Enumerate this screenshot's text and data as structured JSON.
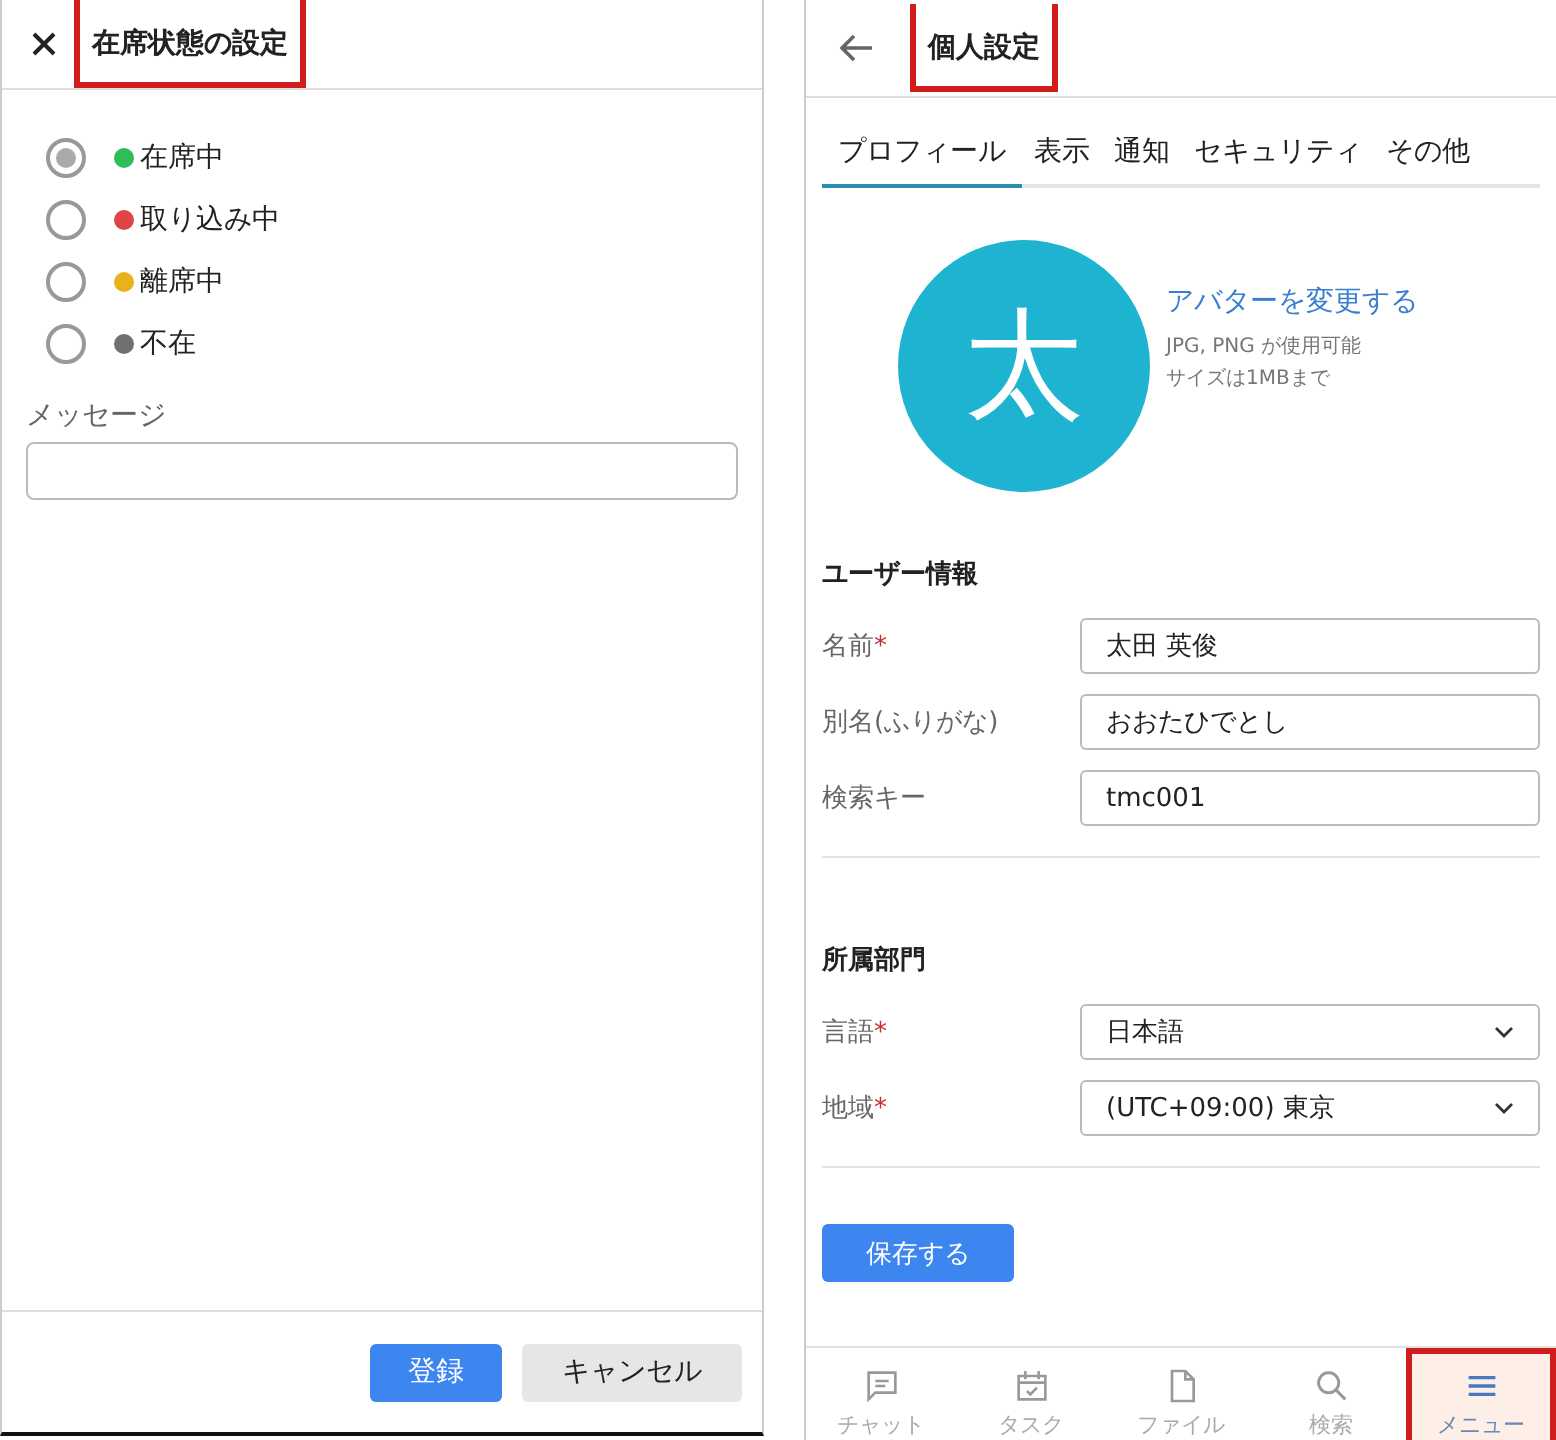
{
  "status_dialog": {
    "title": "在席状態の設定",
    "highlighted": true,
    "statuses": [
      {
        "label": "在席中",
        "color": "#2ebd59",
        "selected": true
      },
      {
        "label": "取り込み中",
        "color": "#e04545",
        "selected": false
      },
      {
        "label": "離席中",
        "color": "#e8b21a",
        "selected": false
      },
      {
        "label": "不在",
        "color": "#707070",
        "selected": false
      }
    ],
    "message": {
      "label": "メッセージ"
    },
    "buttons": [
      {
        "label": "登録",
        "kind": "primary"
      },
      {
        "label": "キャンセル",
        "kind": "secondary"
      }
    ]
  },
  "personal_settings": {
    "title": "個人設定",
    "highlighted": true,
    "tabs": [
      {
        "label": "プロフィール",
        "selected": true
      },
      {
        "label": "表示",
        "selected": false
      },
      {
        "label": "通知",
        "selected": false
      },
      {
        "label": "セキュリティ",
        "selected": false
      },
      {
        "label": "その他",
        "selected": false
      }
    ],
    "avatar": {
      "initial": "太",
      "link": "アバターを変更する",
      "notes": [
        "JPG, PNG が使用可能",
        "サイズは1MBまで"
      ]
    },
    "sections": [
      {
        "heading": "ユーザー情報",
        "fields": [
          {
            "label": "名前",
            "required_mark": "*",
            "kind": "text",
            "value": "太田 英俊"
          },
          {
            "label": "別名(ふりがな)",
            "kind": "text",
            "value": "おおたひでとし"
          },
          {
            "label": "検索キー",
            "kind": "text",
            "value": "tmc001"
          }
        ]
      },
      {
        "heading": "所属部門",
        "fields": [
          {
            "label": "言語",
            "required_mark": "*",
            "kind": "select",
            "value": "日本語"
          },
          {
            "label": "地域",
            "required_mark": "*",
            "kind": "select",
            "value": "(UTC+09:00)  東京"
          }
        ]
      }
    ],
    "save_button": "保存する",
    "bottom_nav": [
      {
        "label": "チャット",
        "kind": "chat",
        "highlighted": false
      },
      {
        "label": "タスク",
        "kind": "task",
        "highlighted": false
      },
      {
        "label": "ファイル",
        "kind": "file",
        "highlighted": false
      },
      {
        "label": "検索",
        "kind": "search",
        "highlighted": false
      },
      {
        "label": "メニュー",
        "kind": "menu",
        "highlighted": true
      }
    ]
  }
}
